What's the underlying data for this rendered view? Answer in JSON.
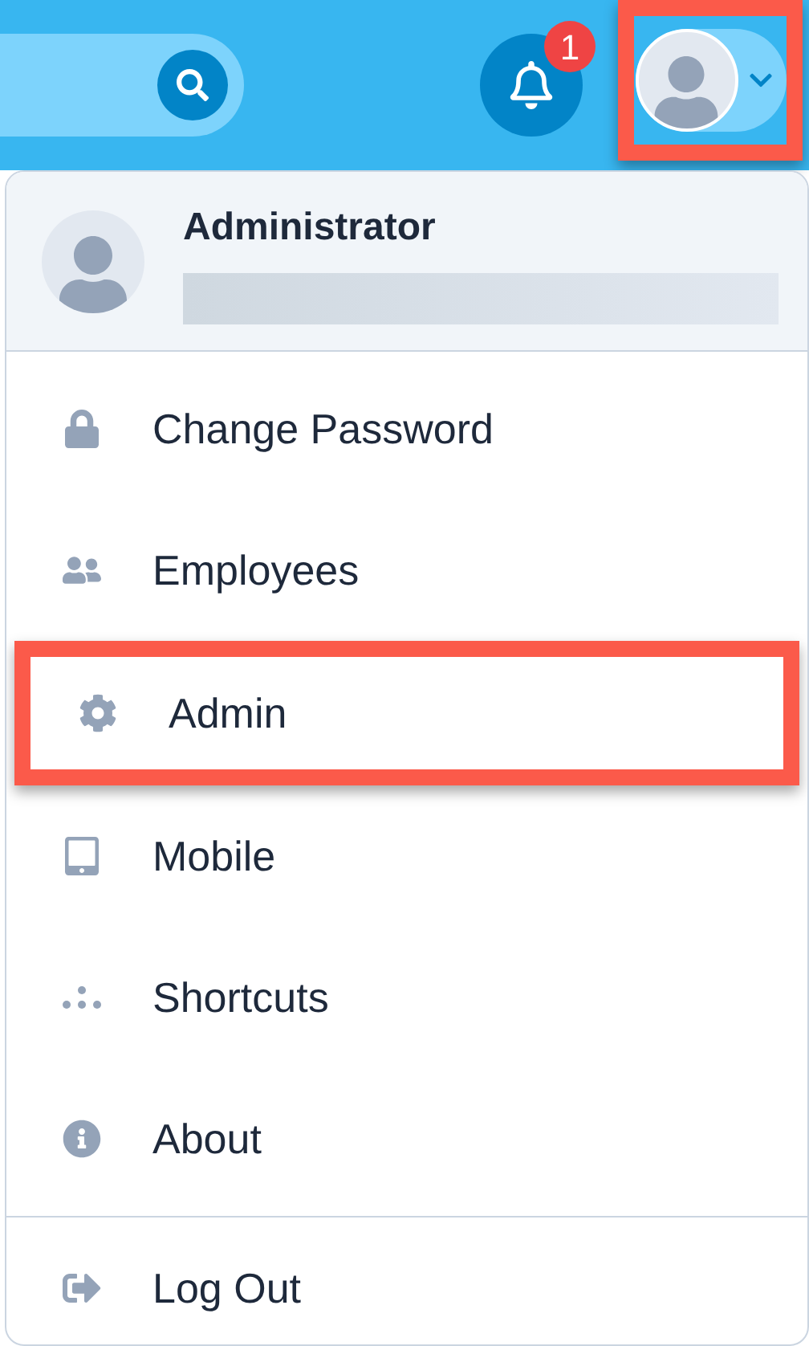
{
  "top_bar": {
    "notifications": {
      "count": "1"
    },
    "user_button": {
      "highlighted": true
    }
  },
  "user_menu": {
    "user_name": "Administrator",
    "items": [
      {
        "label": "Change Password",
        "highlighted": false
      },
      {
        "label": "Employees",
        "highlighted": false
      },
      {
        "label": "Admin",
        "highlighted": true
      },
      {
        "label": "Mobile",
        "highlighted": false
      },
      {
        "label": "Shortcuts",
        "highlighted": false
      },
      {
        "label": "About",
        "highlighted": false
      }
    ],
    "footer_items": [
      {
        "label": "Log Out",
        "highlighted": false
      }
    ]
  }
}
